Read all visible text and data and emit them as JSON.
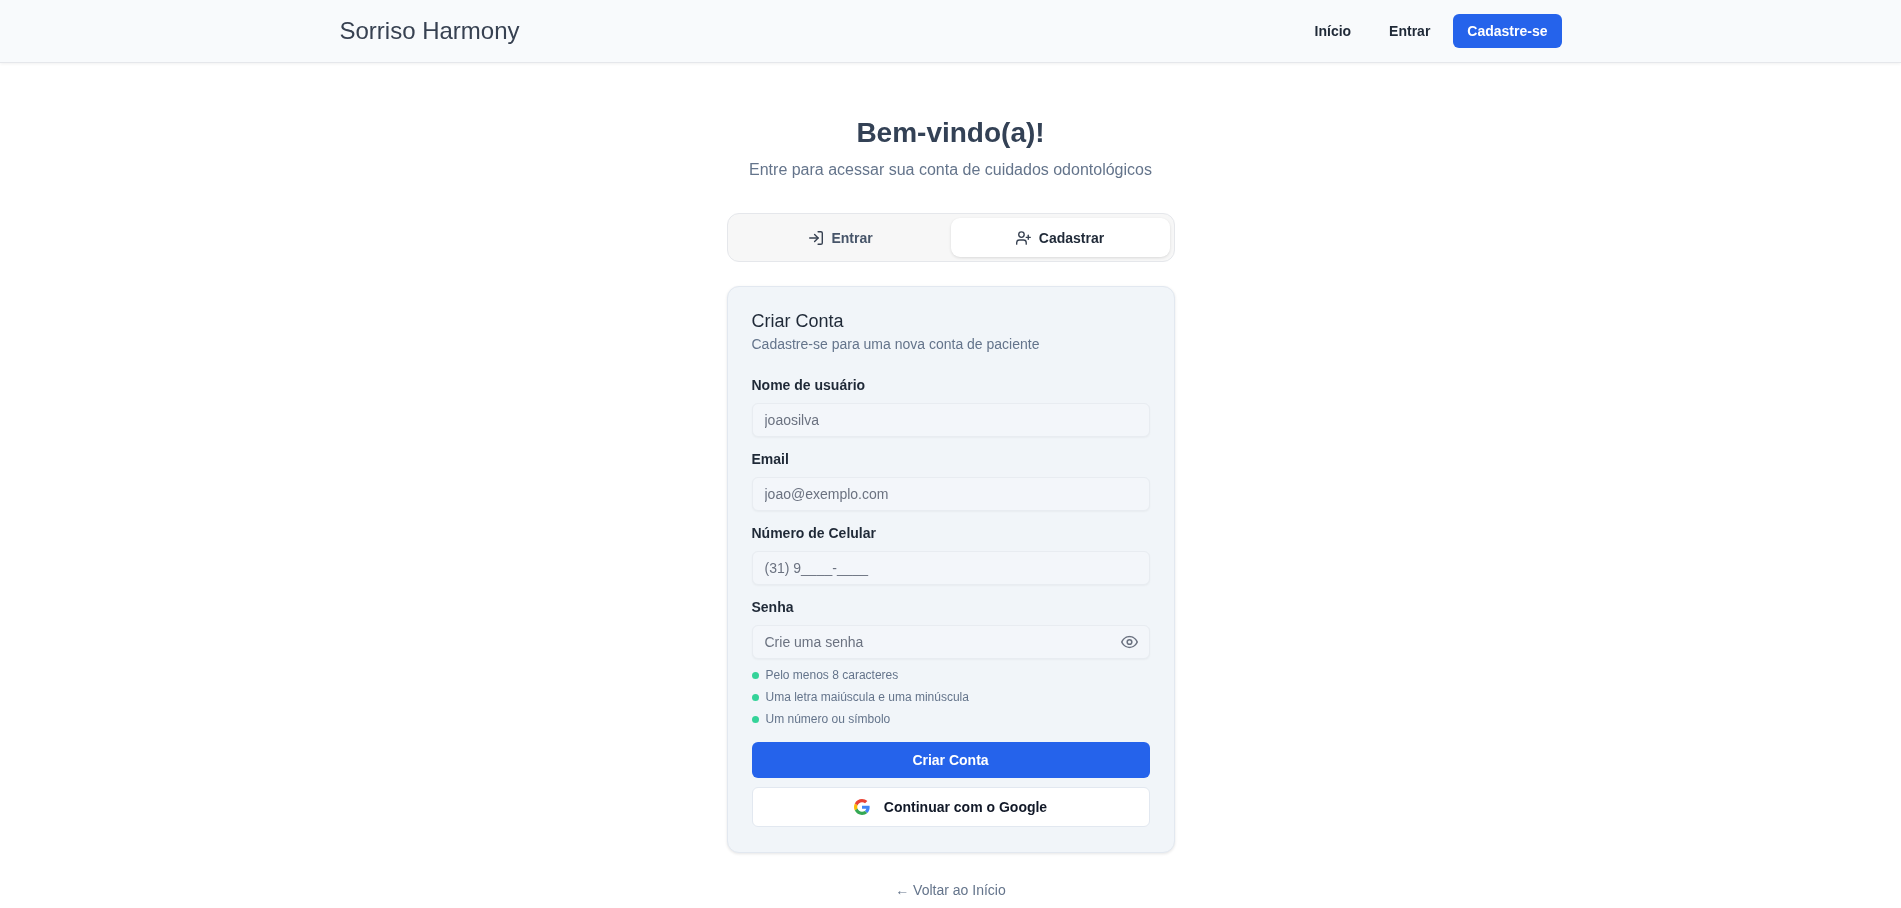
{
  "header": {
    "logo": "Sorriso Harmony",
    "nav": [
      {
        "label": "Início",
        "kind": "link"
      },
      {
        "label": "Entrar",
        "kind": "link"
      },
      {
        "label": "Cadastre-se",
        "kind": "button"
      }
    ]
  },
  "hero": {
    "title": "Bem-vindo(a)!",
    "subtitle": "Entre para acessar sua conta de cuidados odontológicos"
  },
  "tabs": [
    {
      "label": "Entrar",
      "kind": "sign_in",
      "selected": false
    },
    {
      "label": "Cadastrar",
      "kind": "sign_up",
      "selected": true
    }
  ],
  "signup_card": {
    "title": "Criar Conta",
    "subtitle": "Cadastre-se para uma nova conta de paciente",
    "fields": [
      {
        "label": "Nome de usuário",
        "kind": "text",
        "placeholder": "joaosilva"
      },
      {
        "label": "Email",
        "kind": "text",
        "placeholder": "joao@exemplo.com"
      },
      {
        "label": "Número de Celular",
        "kind": "text",
        "placeholder": "(31) 9____-____"
      },
      {
        "label": "Senha",
        "kind": "password",
        "placeholder": "Crie uma senha"
      }
    ],
    "password_requirements": [
      "Pelo menos 8 caracteres",
      "Uma letra maiúscula e uma minúscula",
      "Um número ou símbolo"
    ],
    "submit_button": "Criar Conta",
    "google_button": "Continuar com o Google"
  },
  "back_link": "← Voltar ao Início"
}
